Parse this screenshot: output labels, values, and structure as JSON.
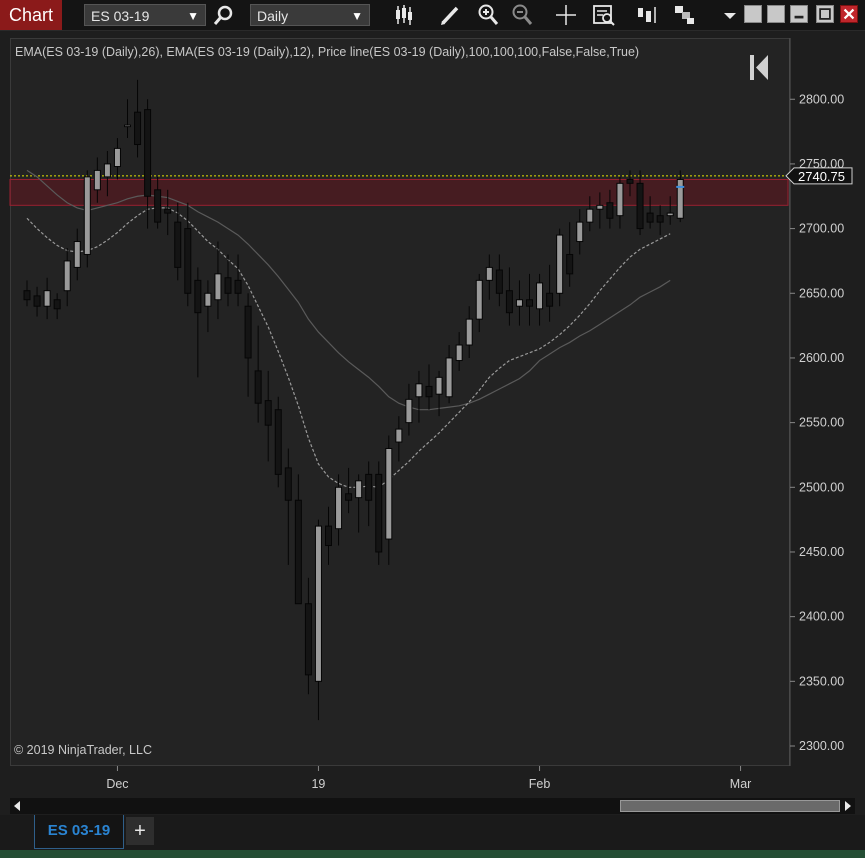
{
  "toolbar": {
    "title": "Chart",
    "instrument": "ES 03-19",
    "interval": "Daily",
    "icons": [
      "search-icon",
      "candlestick-style-icon",
      "draw-pencil-icon",
      "zoom-in-icon",
      "zoom-out-icon",
      "crosshair-icon",
      "data-box-icon",
      "bar-spacing-icon",
      "templates-icon",
      "dropdown-icon",
      "minimize-icon",
      "maximize-icon",
      "close-icon"
    ]
  },
  "chart": {
    "indicator_label": "EMA(ES 03-19 (Daily),26), EMA(ES 03-19 (Daily),12), Price line(ES 03-19 (Daily),100,100,100,False,False,True)",
    "copyright": "© 2019 NinjaTrader, LLC",
    "price_marker": "2740.75"
  },
  "chart_data": {
    "type": "candlestick",
    "ylim": [
      2290,
      2830
    ],
    "y_ticks": [
      "2300.00",
      "2350.00",
      "2400.00",
      "2450.00",
      "2500.00",
      "2550.00",
      "2600.00",
      "2650.00",
      "2700.00",
      "2750.00",
      "2800.00"
    ],
    "x_ticks": [
      {
        "label": "Dec",
        "i": 9
      },
      {
        "label": "19",
        "i": 29
      },
      {
        "label": "Feb",
        "i": 51
      },
      {
        "label": "Mar",
        "i": 71
      }
    ],
    "last_price": 2740.75,
    "zone": [
      2718,
      2738
    ],
    "candles": [
      [
        2652,
        2660,
        2640,
        2645
      ],
      [
        2648,
        2655,
        2632,
        2640
      ],
      [
        2640,
        2662,
        2630,
        2652
      ],
      [
        2645,
        2650,
        2630,
        2638
      ],
      [
        2652,
        2685,
        2640,
        2675
      ],
      [
        2670,
        2700,
        2660,
        2690
      ],
      [
        2680,
        2745,
        2670,
        2740
      ],
      [
        2730,
        2755,
        2720,
        2745
      ],
      [
        2740,
        2760,
        2725,
        2750
      ],
      [
        2748,
        2770,
        2738,
        2762
      ],
      [
        2780,
        2800,
        2770,
        2780
      ],
      [
        2790,
        2815,
        2755,
        2765
      ],
      [
        2792,
        2800,
        2700,
        2725
      ],
      [
        2730,
        2740,
        2700,
        2705
      ],
      [
        2715,
        2730,
        2695,
        2712
      ],
      [
        2705,
        2720,
        2660,
        2670
      ],
      [
        2700,
        2720,
        2640,
        2650
      ],
      [
        2660,
        2670,
        2585,
        2635
      ],
      [
        2640,
        2660,
        2620,
        2650
      ],
      [
        2645,
        2690,
        2630,
        2665
      ],
      [
        2662,
        2680,
        2640,
        2650
      ],
      [
        2660,
        2680,
        2640,
        2650
      ],
      [
        2640,
        2650,
        2570,
        2600
      ],
      [
        2590,
        2625,
        2550,
        2565
      ],
      [
        2567,
        2590,
        2520,
        2548
      ],
      [
        2560,
        2570,
        2500,
        2510
      ],
      [
        2515,
        2530,
        2440,
        2490
      ],
      [
        2490,
        2510,
        2420,
        2410
      ],
      [
        2410,
        2430,
        2340,
        2355
      ],
      [
        2350,
        2475,
        2320,
        2470
      ],
      [
        2470,
        2485,
        2440,
        2455
      ],
      [
        2468,
        2510,
        2455,
        2500
      ],
      [
        2495,
        2515,
        2480,
        2490
      ],
      [
        2492,
        2510,
        2465,
        2505
      ],
      [
        2510,
        2520,
        2470,
        2490
      ],
      [
        2510,
        2520,
        2440,
        2450
      ],
      [
        2460,
        2540,
        2440,
        2530
      ],
      [
        2535,
        2555,
        2520,
        2545
      ],
      [
        2550,
        2580,
        2540,
        2568
      ],
      [
        2570,
        2590,
        2550,
        2580
      ],
      [
        2578,
        2595,
        2560,
        2570
      ],
      [
        2572,
        2590,
        2555,
        2585
      ],
      [
        2570,
        2610,
        2565,
        2600
      ],
      [
        2598,
        2620,
        2590,
        2610
      ],
      [
        2610,
        2640,
        2600,
        2630
      ],
      [
        2630,
        2665,
        2620,
        2660
      ],
      [
        2660,
        2680,
        2645,
        2670
      ],
      [
        2668,
        2680,
        2640,
        2650
      ],
      [
        2652,
        2670,
        2625,
        2635
      ],
      [
        2640,
        2660,
        2625,
        2645
      ],
      [
        2645,
        2665,
        2625,
        2640
      ],
      [
        2638,
        2665,
        2625,
        2658
      ],
      [
        2650,
        2672,
        2628,
        2640
      ],
      [
        2650,
        2700,
        2640,
        2695
      ],
      [
        2680,
        2705,
        2655,
        2665
      ],
      [
        2690,
        2715,
        2680,
        2705
      ],
      [
        2705,
        2725,
        2698,
        2715
      ],
      [
        2715,
        2728,
        2700,
        2718
      ],
      [
        2720,
        2730,
        2700,
        2708
      ],
      [
        2710,
        2740,
        2700,
        2735
      ],
      [
        2738,
        2745,
        2725,
        2735
      ],
      [
        2735,
        2745,
        2695,
        2700
      ],
      [
        2712,
        2725,
        2700,
        2705
      ],
      [
        2710,
        2718,
        2695,
        2705
      ],
      [
        2710,
        2725,
        2703,
        2712
      ],
      [
        2708,
        2745,
        2705,
        2738
      ]
    ],
    "series": [
      {
        "name": "EMA(ES 03-19 (Daily),26)",
        "color": "#5a5a5a",
        "values": [
          2745,
          2740,
          2733,
          2726,
          2720,
          2716,
          2714,
          2716,
          2718,
          2720,
          2723,
          2725,
          2726,
          2725,
          2724,
          2721,
          2718,
          2713,
          2709,
          2705,
          2700,
          2695,
          2688,
          2680,
          2672,
          2663,
          2653,
          2643,
          2630,
          2620,
          2612,
          2604,
          2597,
          2591,
          2585,
          2578,
          2570,
          2565,
          2562,
          2560,
          2560,
          2561,
          2562,
          2563,
          2565,
          2568,
          2572,
          2576,
          2580,
          2584,
          2590,
          2598,
          2603,
          2608,
          2612,
          2617,
          2621,
          2626,
          2631,
          2636,
          2641,
          2647,
          2651,
          2655,
          2660
        ]
      },
      {
        "name": "EMA(ES 03-19 (Daily),12)",
        "color": "#9a9a9a",
        "values": [
          2708,
          2700,
          2693,
          2687,
          2683,
          2682,
          2683,
          2686,
          2691,
          2697,
          2704,
          2710,
          2715,
          2716,
          2716,
          2712,
          2706,
          2698,
          2690,
          2684,
          2676,
          2669,
          2656,
          2640,
          2624,
          2605,
          2585,
          2563,
          2538,
          2518,
          2508,
          2503,
          2500,
          2500,
          2501,
          2500,
          2506,
          2513,
          2520,
          2528,
          2535,
          2542,
          2550,
          2558,
          2566,
          2575,
          2585,
          2592,
          2598,
          2601,
          2604,
          2607,
          2612,
          2618,
          2625,
          2633,
          2642,
          2652,
          2661,
          2670,
          2678,
          2684,
          2688,
          2692,
          2696
        ]
      }
    ]
  }
}
